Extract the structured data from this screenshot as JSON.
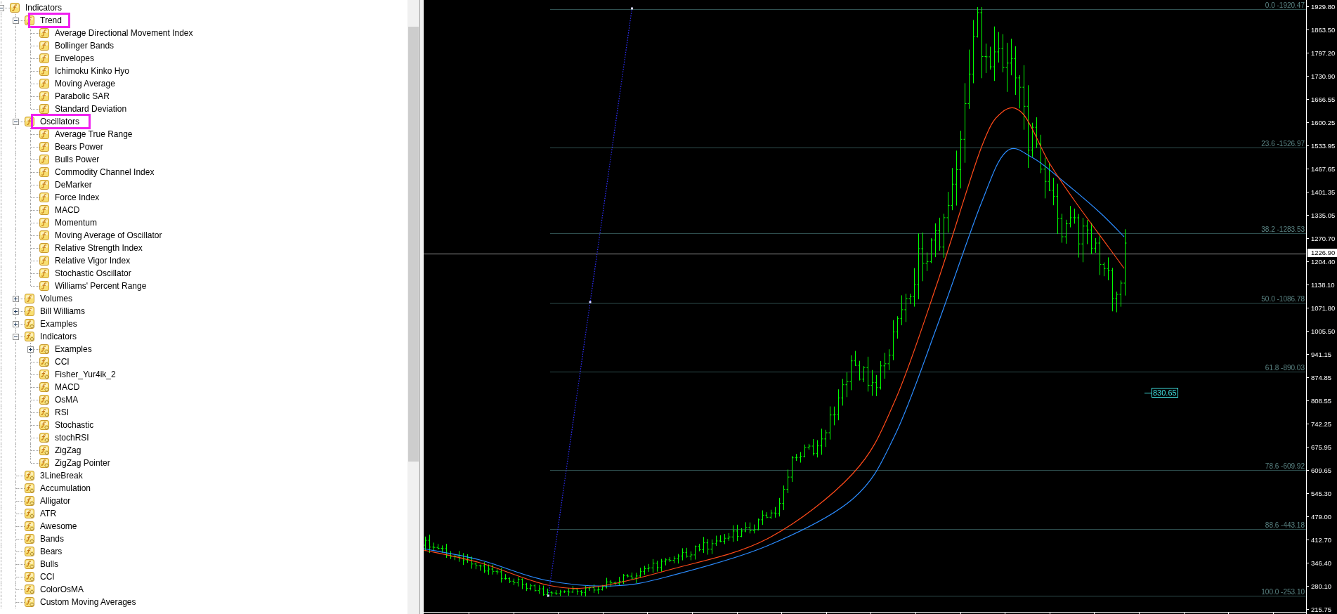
{
  "navigator": {
    "tree": [
      {
        "label": "Indicators",
        "kind": "builtin",
        "expanded": true,
        "highlighted": false,
        "children": [
          {
            "label": "Trend",
            "kind": "builtin",
            "expanded": true,
            "highlighted": true,
            "children": [
              {
                "label": "Average Directional Movement Index",
                "kind": "builtin"
              },
              {
                "label": "Bollinger Bands",
                "kind": "builtin"
              },
              {
                "label": "Envelopes",
                "kind": "builtin"
              },
              {
                "label": "Ichimoku Kinko Hyo",
                "kind": "builtin"
              },
              {
                "label": "Moving Average",
                "kind": "builtin"
              },
              {
                "label": "Parabolic SAR",
                "kind": "builtin"
              },
              {
                "label": "Standard Deviation",
                "kind": "builtin"
              }
            ]
          },
          {
            "label": "Oscillators",
            "kind": "builtin",
            "expanded": true,
            "highlighted": true,
            "children": [
              {
                "label": "Average True Range",
                "kind": "builtin"
              },
              {
                "label": "Bears Power",
                "kind": "builtin"
              },
              {
                "label": "Bulls Power",
                "kind": "builtin"
              },
              {
                "label": "Commodity Channel Index",
                "kind": "builtin"
              },
              {
                "label": "DeMarker",
                "kind": "builtin"
              },
              {
                "label": "Force Index",
                "kind": "builtin"
              },
              {
                "label": "MACD",
                "kind": "builtin"
              },
              {
                "label": "Momentum",
                "kind": "builtin"
              },
              {
                "label": "Moving Average of Oscillator",
                "kind": "builtin"
              },
              {
                "label": "Relative Strength Index",
                "kind": "builtin"
              },
              {
                "label": "Relative Vigor Index",
                "kind": "builtin"
              },
              {
                "label": "Stochastic Oscillator",
                "kind": "builtin"
              },
              {
                "label": "Williams' Percent Range",
                "kind": "builtin"
              }
            ]
          },
          {
            "label": "Volumes",
            "kind": "builtin",
            "expanded": false,
            "highlighted": false
          },
          {
            "label": "Bill Williams",
            "kind": "builtin",
            "expanded": false,
            "highlighted": false
          },
          {
            "label": "Examples",
            "kind": "custom",
            "expanded": false,
            "highlighted": false
          },
          {
            "label": "Indicators",
            "kind": "custom",
            "expanded": true,
            "highlighted": false,
            "children": [
              {
                "label": "Examples",
                "kind": "custom",
                "expanded": false
              },
              {
                "label": "CCI",
                "kind": "custom"
              },
              {
                "label": "Fisher_Yur4ik_2",
                "kind": "custom"
              },
              {
                "label": "MACD",
                "kind": "custom"
              },
              {
                "label": "OsMA",
                "kind": "custom"
              },
              {
                "label": "RSI",
                "kind": "custom"
              },
              {
                "label": "Stochastic",
                "kind": "custom"
              },
              {
                "label": "stochRSI",
                "kind": "custom"
              },
              {
                "label": "ZigZag",
                "kind": "custom"
              },
              {
                "label": "ZigZag Pointer",
                "kind": "custom"
              }
            ]
          },
          {
            "label": "3LineBreak",
            "kind": "custom",
            "highlighted": false
          },
          {
            "label": "Accumulation",
            "kind": "custom",
            "highlighted": false
          },
          {
            "label": "Alligator",
            "kind": "custom",
            "highlighted": false
          },
          {
            "label": "ATR",
            "kind": "custom",
            "highlighted": false
          },
          {
            "label": "Awesome",
            "kind": "custom",
            "highlighted": false
          },
          {
            "label": "Bands",
            "kind": "custom",
            "highlighted": false
          },
          {
            "label": "Bears",
            "kind": "custom",
            "highlighted": false
          },
          {
            "label": "Bulls",
            "kind": "custom",
            "highlighted": false
          },
          {
            "label": "CCI",
            "kind": "custom",
            "highlighted": false
          },
          {
            "label": "ColorOsMA",
            "kind": "custom",
            "highlighted": false
          },
          {
            "label": "Custom Moving Averages",
            "kind": "custom",
            "highlighted": false
          }
        ]
      }
    ]
  },
  "chart": {
    "fibonacci_levels": [
      "0.0 -1920.47",
      "23.6 -1526.97",
      "38.2 -1283.53",
      "50.0 -1086.78",
      "61.8 -890.03",
      "78.6 -609.92",
      "88.6 -443.18",
      "100.0 -253.10"
    ],
    "price_tag": "830.65",
    "price_axis": [
      "1929.80",
      "1863.50",
      "1797.20",
      "1730.90",
      "1666.55",
      "1600.25",
      "1533.95",
      "1467.65",
      "1401.35",
      "1335.05",
      "1270.70",
      "1204.40",
      "1138.10",
      "1071.80",
      "1005.50",
      "941.15",
      "874.85",
      "808.55",
      "742.25",
      "675.95",
      "609.65",
      "545.30",
      "479.00",
      "412.70",
      "346.40",
      "280.10",
      "215.75"
    ],
    "current_price": "1226.90"
  }
}
